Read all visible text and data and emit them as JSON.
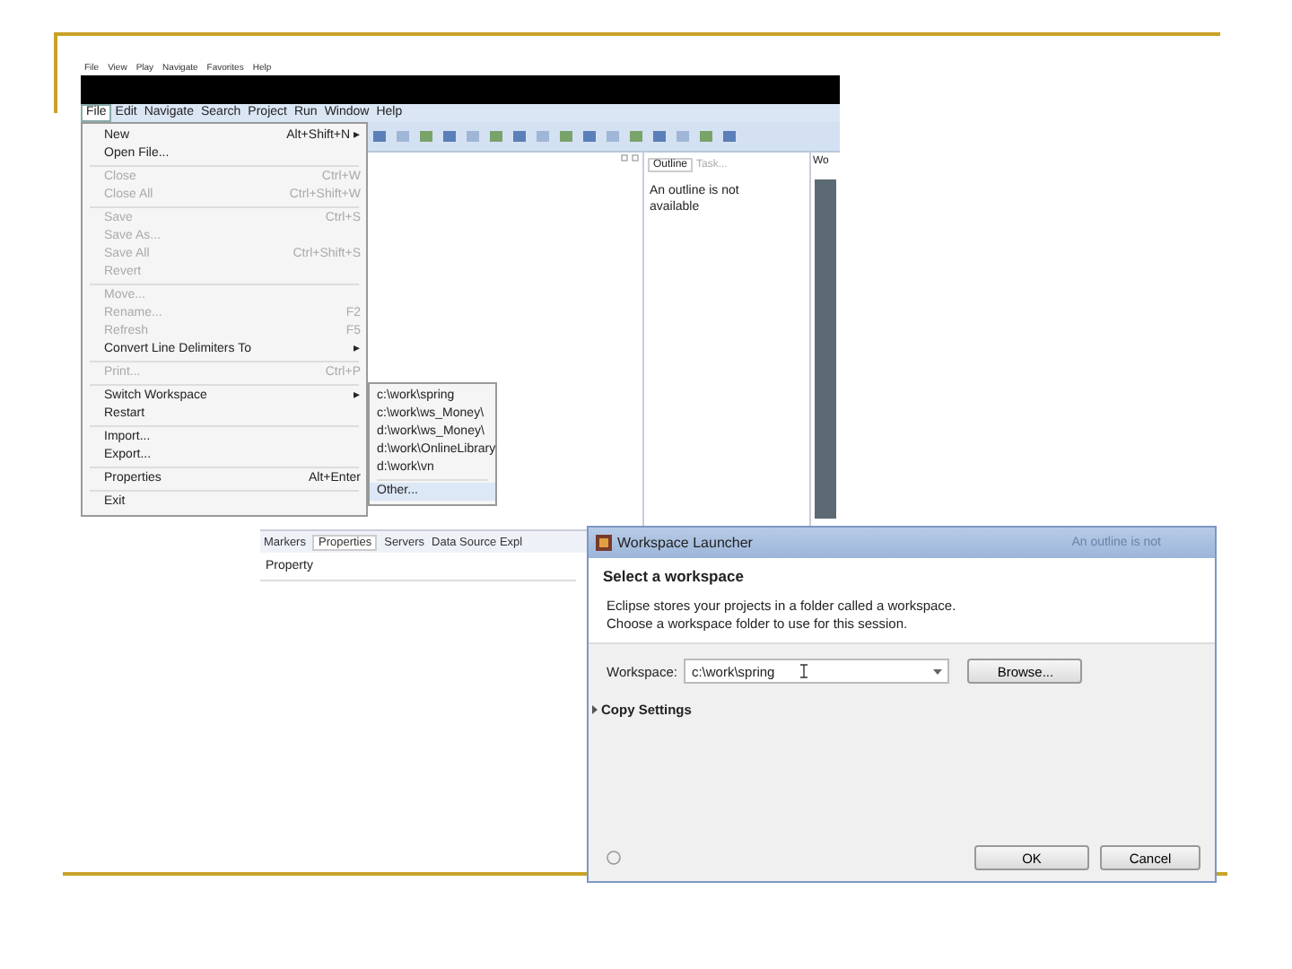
{
  "eclipse_window": {
    "top_menu_bar": [
      "File",
      "View",
      "Play",
      "Navigate",
      "Favorites",
      "Help"
    ],
    "menu_bar": [
      {
        "label": "File",
        "selected": true
      },
      {
        "label": "Edit",
        "selected": false
      },
      {
        "label": "Navigate",
        "selected": false
      },
      {
        "label": "Search",
        "selected": false
      },
      {
        "label": "Project",
        "selected": false
      },
      {
        "label": "Run",
        "selected": false
      },
      {
        "label": "Window",
        "selected": false
      },
      {
        "label": "Help",
        "selected": false
      }
    ],
    "file_menu": [
      {
        "kind": "item",
        "label": "New",
        "shortcut": "Alt+Shift+N ▸",
        "disabled": false
      },
      {
        "kind": "item",
        "label": "Open File...",
        "disabled": false
      },
      {
        "kind": "separator"
      },
      {
        "kind": "item",
        "label": "Close",
        "shortcut": "Ctrl+W",
        "disabled": true
      },
      {
        "kind": "item",
        "label": "Close All",
        "shortcut": "Ctrl+Shift+W",
        "disabled": true
      },
      {
        "kind": "separator"
      },
      {
        "kind": "item",
        "label": "Save",
        "shortcut": "Ctrl+S",
        "disabled": true
      },
      {
        "kind": "item",
        "label": "Save As...",
        "disabled": true
      },
      {
        "kind": "item",
        "label": "Save All",
        "shortcut": "Ctrl+Shift+S",
        "disabled": true
      },
      {
        "kind": "item",
        "label": "Revert",
        "disabled": true
      },
      {
        "kind": "separator"
      },
      {
        "kind": "item",
        "label": "Move...",
        "disabled": true
      },
      {
        "kind": "item",
        "label": "Rename...",
        "shortcut": "F2",
        "disabled": true
      },
      {
        "kind": "item",
        "label": "Refresh",
        "shortcut": "F5",
        "disabled": true
      },
      {
        "kind": "item",
        "label": "Convert Line Delimiters To",
        "shortcut": "▸",
        "disabled": false
      },
      {
        "kind": "separator"
      },
      {
        "kind": "item",
        "label": "Print...",
        "shortcut": "Ctrl+P",
        "disabled": true
      },
      {
        "kind": "separator"
      },
      {
        "kind": "item",
        "label": "Switch Workspace",
        "shortcut": "▸",
        "disabled": false
      },
      {
        "kind": "item",
        "label": "Restart",
        "disabled": false
      },
      {
        "kind": "separator"
      },
      {
        "kind": "item",
        "label": "Import...",
        "disabled": false
      },
      {
        "kind": "item",
        "label": "Export...",
        "disabled": false
      },
      {
        "kind": "separator"
      },
      {
        "kind": "item",
        "label": "Properties",
        "shortcut": "Alt+Enter",
        "disabled": false
      },
      {
        "kind": "separator"
      },
      {
        "kind": "item",
        "label": "Exit",
        "disabled": false
      }
    ],
    "submenu": [
      {
        "kind": "item",
        "label": "c:\\work\\spring",
        "selected": false
      },
      {
        "kind": "item",
        "label": "c:\\work\\ws_Money\\",
        "selected": false
      },
      {
        "kind": "item",
        "label": "d:\\work\\ws_Money\\",
        "selected": false
      },
      {
        "kind": "item",
        "label": "d:\\work\\OnlineLibrary",
        "selected": false
      },
      {
        "kind": "item",
        "label": "d:\\work\\vn",
        "selected": false
      },
      {
        "kind": "separator"
      },
      {
        "kind": "item",
        "label": "Other...",
        "selected": true
      }
    ],
    "outline_panel": {
      "tabs": [
        {
          "label": "Outline",
          "selected": true
        },
        {
          "label": "Task...",
          "selected": false
        }
      ],
      "message": "An outline is not available"
    },
    "side_tab": "Wo",
    "bottom_panel": {
      "tabs": [
        {
          "label": "Markers",
          "selected": false
        },
        {
          "label": "Properties",
          "selected": true
        },
        {
          "label": "Servers",
          "selected": false
        },
        {
          "label": "Data Source Expl",
          "selected": false
        }
      ],
      "column": "Property"
    }
  },
  "dialog": {
    "title": "Workspace Launcher",
    "title_ghost": "An outline is not",
    "heading": "Select a workspace",
    "description": [
      "Eclipse stores your projects in a folder called a workspace.",
      "Choose a workspace folder to use for this session."
    ],
    "workspace_label": "Workspace:",
    "workspace_value": "c:\\work\\spring",
    "browse": "Browse...",
    "copy_settings": "Copy Settings",
    "ok": "OK",
    "cancel": "Cancel"
  }
}
